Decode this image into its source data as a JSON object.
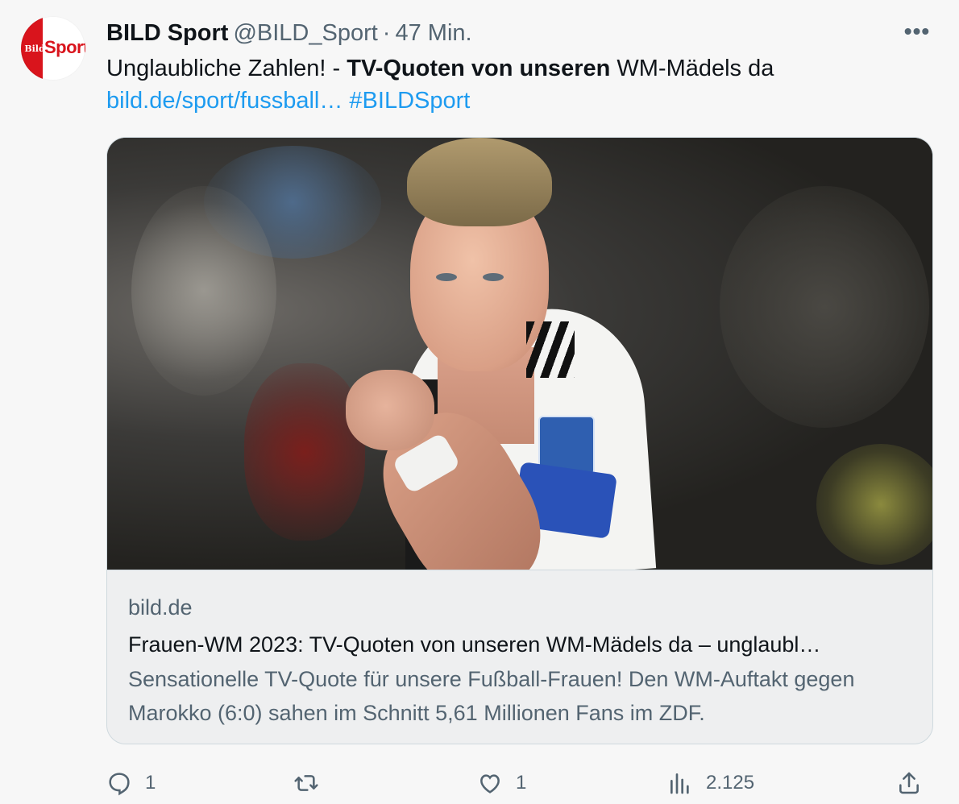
{
  "tweet": {
    "author": {
      "display_name": "BILD Sport",
      "handle": "@BILD_Sport",
      "separator": "·",
      "time": "47 Min.",
      "avatar_text_left": "Bild",
      "avatar_text_right": "Sport"
    },
    "more_label": "•••",
    "text": {
      "part1": "Unglaubliche Zahlen! - ",
      "bold": "TV-Quoten von unseren",
      "part2": " WM-Mädels da",
      "link": "bild.de/sport/fussball…",
      "hashtag": " #BILDSport"
    },
    "card": {
      "domain": "bild.de",
      "title": "Frauen-WM 2023: TV-Quoten von unseren WM-Mädels da – unglaubl…",
      "description": "Sensationelle TV-Quote für unsere Fußball-Frauen! Den WM-Auftakt gegen Marokko (6:0) sahen im Schnitt 5,61 Millionen Fans im ZDF."
    },
    "actions": {
      "replies": "1",
      "retweets": "",
      "likes": "1",
      "views": "2.125"
    }
  },
  "colors": {
    "link": "#1d9bf0",
    "secondary_text": "#536471",
    "brand_red": "#d9141c"
  },
  "icons": [
    "reply-icon",
    "retweet-icon",
    "like-icon",
    "views-icon",
    "share-icon",
    "more-icon"
  ]
}
